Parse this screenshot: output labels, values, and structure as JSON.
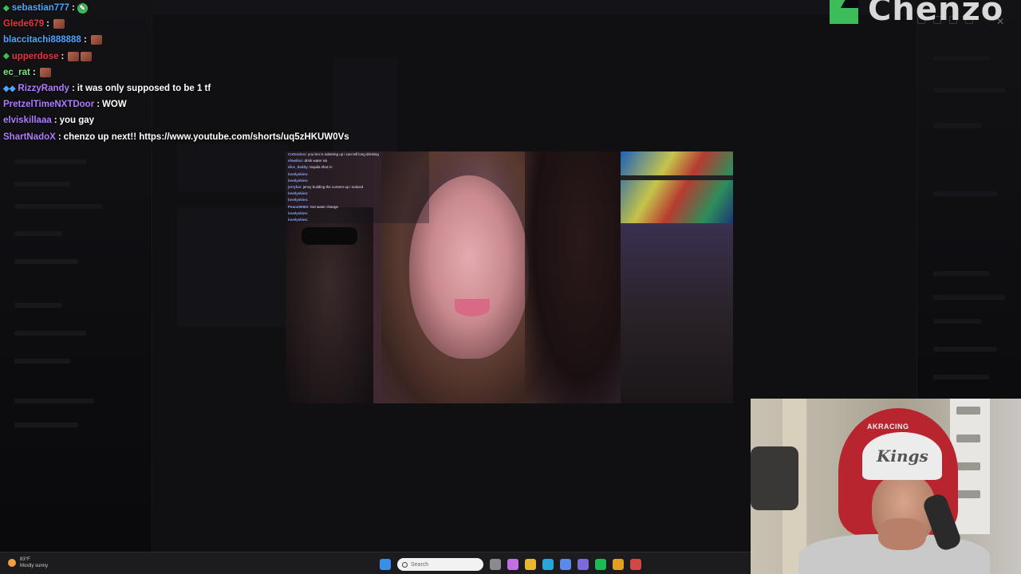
{
  "logo": {
    "text": "Chenzo"
  },
  "chat": [
    {
      "badge": "◆",
      "badge_color": "#3dbd5a",
      "user": "sebastian777",
      "user_color": "#4da6ff",
      "message": "",
      "emotes": [
        "green"
      ]
    },
    {
      "badge": "",
      "user": "Glede679",
      "user_color": "#e5383b",
      "message": "",
      "emotes": [
        "brown"
      ]
    },
    {
      "badge": "",
      "user": "blaccitachi888888",
      "user_color": "#4da6ff",
      "message": "",
      "emotes": [
        "brown"
      ]
    },
    {
      "badge": "◆",
      "badge_color": "#3dbd5a",
      "user": "upperdose",
      "user_color": "#e5383b",
      "message": "",
      "emotes": [
        "brown",
        "brown"
      ]
    },
    {
      "badge": "",
      "user": "ec_rat",
      "user_color": "#7fe57f",
      "message": "",
      "emotes": [
        "brown"
      ]
    },
    {
      "badge": "◆◆",
      "badge_color": "#4da6ff",
      "user": "RizzyRandy",
      "user_color": "#b07cff",
      "message": "it was only supposed to be 1 tf",
      "emotes": []
    },
    {
      "badge": "",
      "user": "PretzelTimeNXTDoor",
      "user_color": "#b07cff",
      "message": "WOW",
      "emotes": []
    },
    {
      "badge": "",
      "user": "elviskillaaa",
      "user_color": "#b07cff",
      "message": "you gay",
      "emotes": []
    },
    {
      "badge": "",
      "user": "ShartNadoX",
      "user_color": "#b07cff",
      "message": "chenzo up next!! https://www.youtube.com/shorts/uq5zHKUW0Vs",
      "emotes": []
    }
  ],
  "video_chat": [
    {
      "user": "Cottonbox",
      "message": "you bro is sobering up i can tell long drinking"
    },
    {
      "user": "efswilon",
      "message": "drink water sis"
    },
    {
      "user": "dice_daddy",
      "message": "tequila shot rn"
    },
    {
      "user": "lovelyskies",
      "message": ""
    },
    {
      "user": "lovelyskies",
      "message": ""
    },
    {
      "user": "jerryluv",
      "message": "jenny building the content up i noticed"
    },
    {
      "user": "lovelyskies",
      "message": ""
    },
    {
      "user": "lovelyskies",
      "message": ""
    },
    {
      "user": "Peanut9083",
      "message": "Get water change"
    },
    {
      "user": "lovelyskies",
      "message": ""
    },
    {
      "user": "lovelyskies",
      "message": ""
    }
  ],
  "webcam": {
    "chair_brand": "AKRACING",
    "cap_text": "Kings"
  },
  "taskbar": {
    "weather_temp": "83°F",
    "weather_desc": "Mostly sunny",
    "search_placeholder": "Search",
    "icons": [
      {
        "name": "start-icon",
        "color": "#3a8ee6"
      },
      {
        "name": "task-view-icon",
        "color": "#8a8a90"
      },
      {
        "name": "copilot-icon",
        "color": "#c070e0"
      },
      {
        "name": "file-explorer-icon",
        "color": "#e8b830"
      },
      {
        "name": "edge-icon",
        "color": "#2aa5d8"
      },
      {
        "name": "store-icon",
        "color": "#5a8ae8"
      },
      {
        "name": "teams-icon",
        "color": "#7b6ad8"
      },
      {
        "name": "spotify-icon",
        "color": "#1db954"
      },
      {
        "name": "chrome-icon",
        "color": "#e0a020"
      },
      {
        "name": "app-icon",
        "color": "#d04848"
      }
    ]
  }
}
